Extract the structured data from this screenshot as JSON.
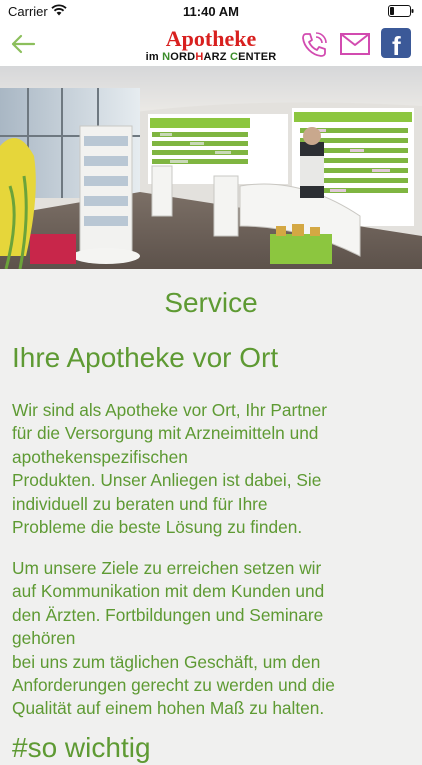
{
  "status_bar": {
    "carrier": "Carrier",
    "time": "11:40 AM"
  },
  "nav": {
    "back_icon": "arrow-left-icon",
    "logo": {
      "title": "Apotheke",
      "subtitle_im": "im",
      "subtitle_n": "N",
      "subtitle_ordharz_1": "ORD",
      "subtitle_h": "H",
      "subtitle_ordharz_2": "ARZ",
      "subtitle_c": "C",
      "subtitle_enter": "ENTER"
    },
    "phone_icon": "phone-icon",
    "mail_icon": "mail-icon",
    "facebook_icon": "facebook-icon",
    "facebook_letter": "f"
  },
  "hero": {
    "image": "pharmacy-interior-photo"
  },
  "main": {
    "section_title": "Service",
    "page_title": "Ihre Apotheke vor Ort",
    "paragraph1_lines": [
      "Wir sind als Apotheke vor Ort, Ihr Partner",
      "für die Versorgung mit Arzneimitteln und",
      "apothekenspezifischen",
      "Produkten. Unser Anliegen ist dabei, Sie",
      "individuell zu beraten und für Ihre",
      "Probleme die beste Lösung zu finden."
    ],
    "paragraph2_lines": [
      "Um unsere Ziele zu erreichen setzen wir",
      "auf Kommunikation mit dem Kunden und",
      "den Ärzten. Fortbildungen und Seminare",
      "gehören",
      "bei uns zum täglichen Geschäft, um den",
      "Anforderungen gerecht zu werden und die",
      "Qualität auf einem hohen Maß zu halten."
    ],
    "next_heading_partial": "#so wichtig"
  },
  "colors": {
    "accent_green": "#5e9a33",
    "logo_red": "#d8201f",
    "icon_pink": "#d24bb0",
    "facebook_blue": "#3b5998",
    "background": "#f0f0ef"
  }
}
